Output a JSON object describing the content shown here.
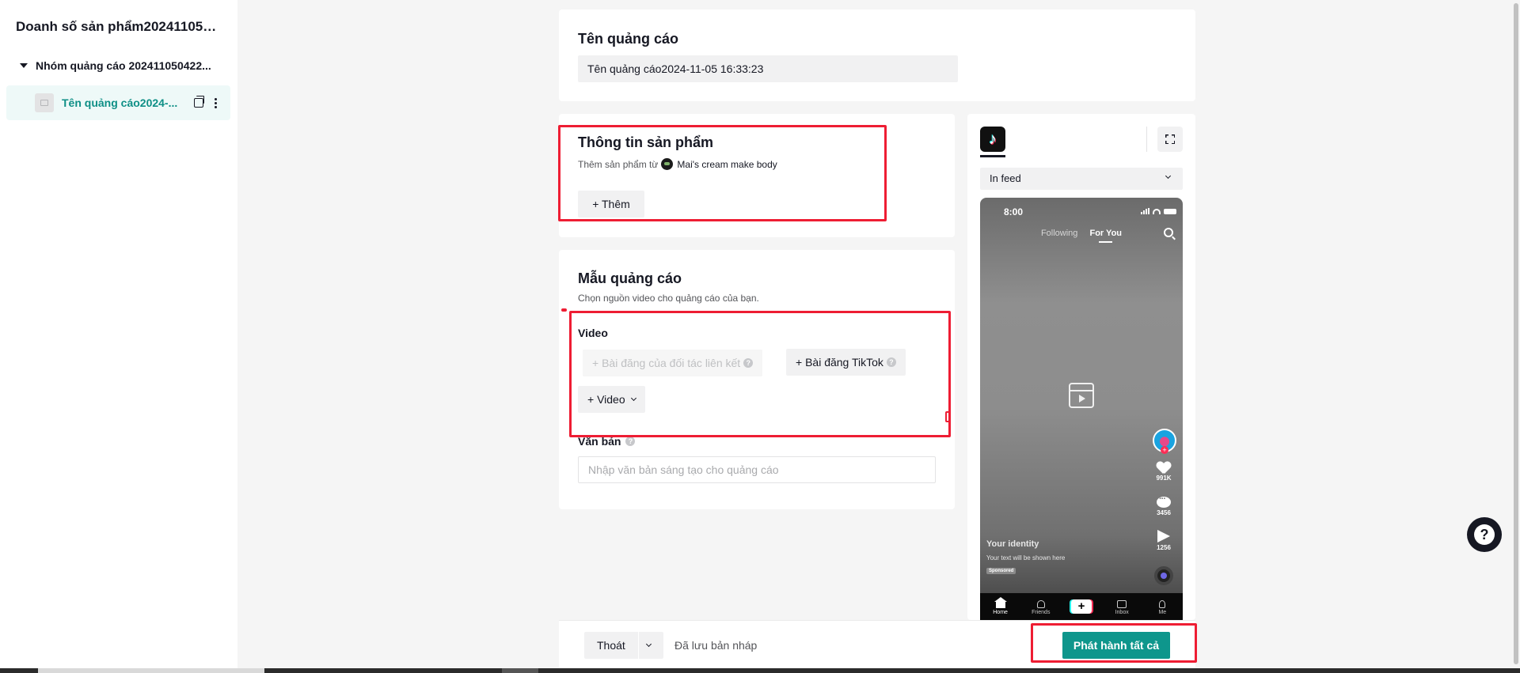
{
  "sidebar": {
    "campaign_title": "Doanh số sản phẩm2024110516...",
    "adgroup_label": "Nhóm quảng cáo 202411050422...",
    "ad_label": "Tên quảng cáo2024-..."
  },
  "ad_name": {
    "title": "Tên quảng cáo",
    "value": "Tên quảng cáo2024-11-05 16:33:23"
  },
  "product_info": {
    "title": "Thông tin sản phẩm",
    "subtitle_prefix": "Thêm sản phẩm từ",
    "shop_name": "Mai's cream make body",
    "add_button": "+ Thêm"
  },
  "creative": {
    "title": "Mẫu quảng cáo",
    "subtitle": "Chọn nguồn video cho quảng cáo của bạn.",
    "video_label": "Video",
    "affiliate_button": "+ Bài đăng của đối tác liên kết",
    "tiktok_post_button": "+ Bài đăng TikTok",
    "video_button": "+ Video",
    "text_label": "Văn bản",
    "text_placeholder": "Nhập văn bản sáng tạo cho quảng cáo"
  },
  "preview": {
    "placement": "In feed",
    "time": "8:00",
    "tab_following": "Following",
    "tab_foryou": "For You",
    "likes": "991K",
    "comments": "3456",
    "shares": "1256",
    "identity": "Your identity",
    "caption": "Your text will be shown here",
    "sponsored": "Sponsored",
    "nav": [
      "Home",
      "Friends",
      "Inbox",
      "Me"
    ]
  },
  "action_bar": {
    "exit_label": "Thoát",
    "draft_status": "Đã lưu bản nháp",
    "publish_label": "Phát hành tất cả"
  },
  "colors": {
    "accent": "#0e968c",
    "annotation": "#ee1d33"
  },
  "icons": [
    "caret-down-icon",
    "copy-icon",
    "more-icon",
    "shop-avatar-icon",
    "help-icon",
    "chevron-down-icon",
    "tiktok-logo-icon",
    "expand-icon",
    "video-placeholder-icon",
    "search-icon"
  ]
}
